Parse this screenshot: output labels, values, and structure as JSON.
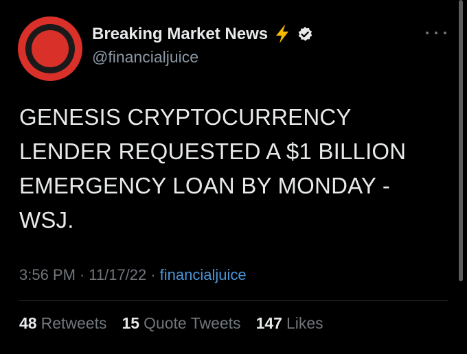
{
  "author": {
    "name": "Breaking Market News",
    "handle": "@financialjuice",
    "avatar_colors": {
      "ring": "#d9302a",
      "inner": "#1a1a1a"
    },
    "badges": [
      "lightning-bolt-emoji",
      "verified-check"
    ]
  },
  "tweet": {
    "text": "GENESIS CRYPTOCURRENCY\nLENDER REQUESTED A $1 BILLION\nEMERGENCY LOAN BY MONDAY -\nWSJ.",
    "time": "3:56 PM",
    "separator": "·",
    "date": "11/17/22",
    "source": "financialjuice"
  },
  "stats": {
    "retweets": {
      "count": "48",
      "label": "Retweets"
    },
    "quote_tweets": {
      "count": "15",
      "label": "Quote Tweets"
    },
    "likes": {
      "count": "147",
      "label": "Likes"
    }
  },
  "colors": {
    "background": "#000000",
    "text": "#e7e9ea",
    "secondary": "#71767b",
    "link": "#4a95d8",
    "verified_badge": "#e7e9ea",
    "bolt": "#f5b800"
  }
}
